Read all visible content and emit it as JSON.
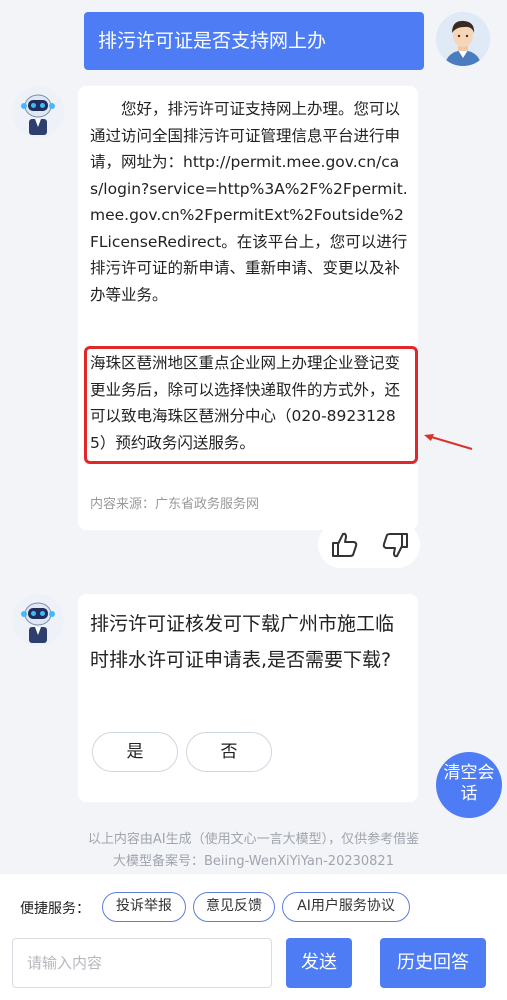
{
  "user_question": "排污许可证是否支持网上办",
  "answer": {
    "body": "您好，排污许可证支持网上办理。您可以通过访问全国排污许可证管理信息平台进行申请，网址为：http://permit.mee.gov.cn/cas/login?service=http%3A%2F%2Fpermit.mee.gov.cn%2FpermitExt%2Foutside%2FLicenseRedirect。在该平台上，您可以进行排污许可证的新申请、重新申请、变更以及补办等业务。",
    "highlight": "海珠区琶洲地区重点企业网上办理企业登记变更业务后，除可以选择快递取件的方式外，还可以致电海珠区琶洲分中心（020-89231285）预约政务闪送服务。",
    "source": "内容来源：广东省政务服务网"
  },
  "followup": {
    "question": "排污许可证核发可下载广州市施工临时排水许可证申请表,是否需要下载?",
    "yes_label": "是",
    "no_label": "否"
  },
  "clear_button_label": "清空会话",
  "disclaimer": {
    "line1": "以上内容由AI生成（使用文心一言大模型），仅供参考借鉴",
    "line2": "大模型备案号：Beiing-WenXiYiYan-20230821"
  },
  "quick_services": {
    "label": "便捷服务：",
    "items": [
      "投诉举报",
      "意见反馈",
      "AI用户服务协议"
    ]
  },
  "input": {
    "placeholder": "请输入内容",
    "value": ""
  },
  "send_label": "发送",
  "history_label": "历史回答",
  "colors": {
    "accent": "#4d7cf5",
    "highlight_border": "#e0272a",
    "background": "#f2f4f8"
  },
  "icons": [
    "user-avatar-icon",
    "robot-avatar-icon",
    "thumbs-up-icon",
    "thumbs-down-icon",
    "red-arrow-icon"
  ]
}
